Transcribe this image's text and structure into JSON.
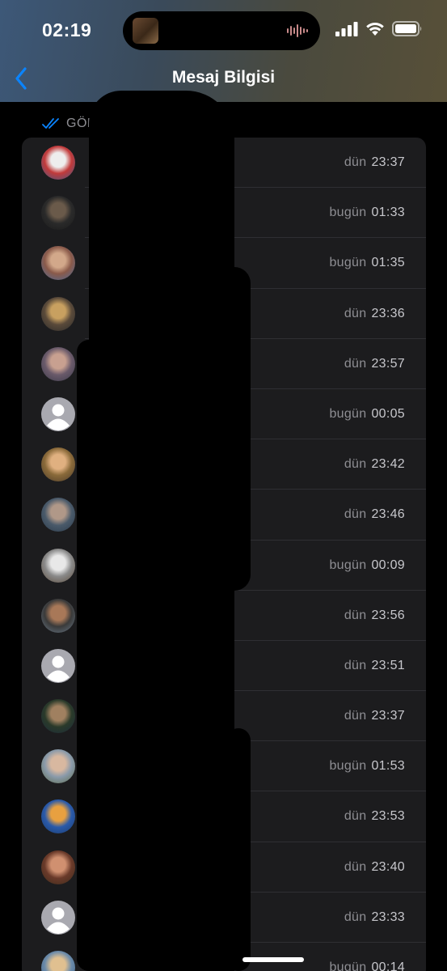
{
  "status_bar": {
    "time": "02:19"
  },
  "nav": {
    "title": "Mesaj Bilgisi"
  },
  "section": {
    "label": "GÖREN"
  },
  "colors": {
    "accent": "#0a84ff",
    "background": "#000000",
    "card": "#1c1c1e",
    "secondary_text": "#8e8e93"
  },
  "rows": [
    {
      "day": "dün",
      "time": "23:37",
      "avatar": "photo"
    },
    {
      "day": "bugün",
      "time": "01:33",
      "avatar": "photo"
    },
    {
      "day": "bugün",
      "time": "01:35",
      "avatar": "photo"
    },
    {
      "day": "dün",
      "time": "23:36",
      "avatar": "photo"
    },
    {
      "day": "dün",
      "time": "23:57",
      "avatar": "photo"
    },
    {
      "day": "bugün",
      "time": "00:05",
      "avatar": "default"
    },
    {
      "day": "dün",
      "time": "23:42",
      "avatar": "photo"
    },
    {
      "day": "dün",
      "time": "23:46",
      "avatar": "photo"
    },
    {
      "day": "bugün",
      "time": "00:09",
      "avatar": "photo"
    },
    {
      "day": "dün",
      "time": "23:56",
      "avatar": "photo"
    },
    {
      "day": "dün",
      "time": "23:51",
      "avatar": "default"
    },
    {
      "day": "dün",
      "time": "23:37",
      "avatar": "photo"
    },
    {
      "day": "bugün",
      "time": "01:53",
      "avatar": "photo"
    },
    {
      "day": "dün",
      "time": "23:53",
      "avatar": "photo"
    },
    {
      "day": "dün",
      "time": "23:40",
      "avatar": "photo"
    },
    {
      "day": "dün",
      "time": "23:33",
      "avatar": "default"
    },
    {
      "day": "bugün",
      "time": "00:14",
      "avatar": "photo"
    }
  ]
}
